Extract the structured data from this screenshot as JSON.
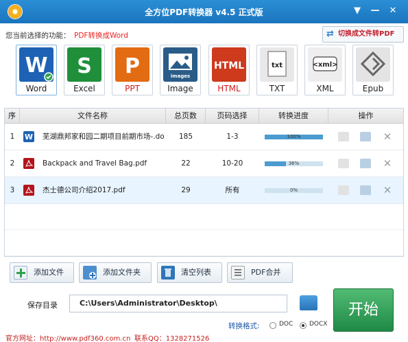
{
  "window": {
    "title": "全方位PDF转换器 v4.5 正式版"
  },
  "function": {
    "label": "您当前选择的功能：",
    "value": "PDF转换成Word",
    "switch_label": "切换成文件转PDF"
  },
  "formats": [
    {
      "label": "Word",
      "icon": "word-icon",
      "color": "#1d62b4"
    },
    {
      "label": "Excel",
      "icon": "excel-icon",
      "color": "#1f8f3a"
    },
    {
      "label": "PPT",
      "icon": "ppt-icon",
      "color": "#e36b12"
    },
    {
      "label": "Image",
      "icon": "image-icon",
      "color": "#2a5c88"
    },
    {
      "label": "HTML",
      "icon": "html-icon",
      "color": "#cd3a1c"
    },
    {
      "label": "TXT",
      "icon": "txt-icon",
      "color": "#e8e8e8"
    },
    {
      "label": "XML",
      "icon": "xml-icon",
      "color": "#eeeeee"
    },
    {
      "label": "Epub",
      "icon": "epub-icon",
      "color": "#e4e4e4"
    }
  ],
  "table": {
    "headers": [
      "序",
      "文件名称",
      "总页数",
      "页码选择",
      "转换进度",
      "操作"
    ],
    "rows": [
      {
        "index": "1",
        "name": "芜湖鼎邦家和园二期项目前期市场-.do",
        "pages": "185",
        "range": "1-3",
        "progress_label": "100%",
        "progress": 1.0,
        "type": "word"
      },
      {
        "index": "2",
        "name": "Backpack and Travel Bag.pdf",
        "pages": "22",
        "range": "10-20",
        "progress_label": "36%",
        "progress": 0.36,
        "type": "pdf"
      },
      {
        "index": "3",
        "name": "杰士德公司介绍2017.pdf",
        "pages": "29",
        "range": "所有",
        "progress_label": "0%",
        "progress": 0.0,
        "type": "pdf"
      }
    ]
  },
  "buttons": {
    "add_file": "添加文件",
    "add_folder": "添加文件夹",
    "clear_list": "清空列表",
    "merge_pdf": "PDF合并",
    "start": "开始"
  },
  "save": {
    "label": "保存目录",
    "path": "C:\\Users\\Administrator\\Desktop\\"
  },
  "conversion": {
    "label": "转换格式:",
    "options": [
      "DOC",
      "DOCX"
    ],
    "selected": "DOCX"
  },
  "footer": {
    "website": "官方网址：http://www.pdf360.com.cn",
    "qq": "联系QQ：1328271526"
  }
}
